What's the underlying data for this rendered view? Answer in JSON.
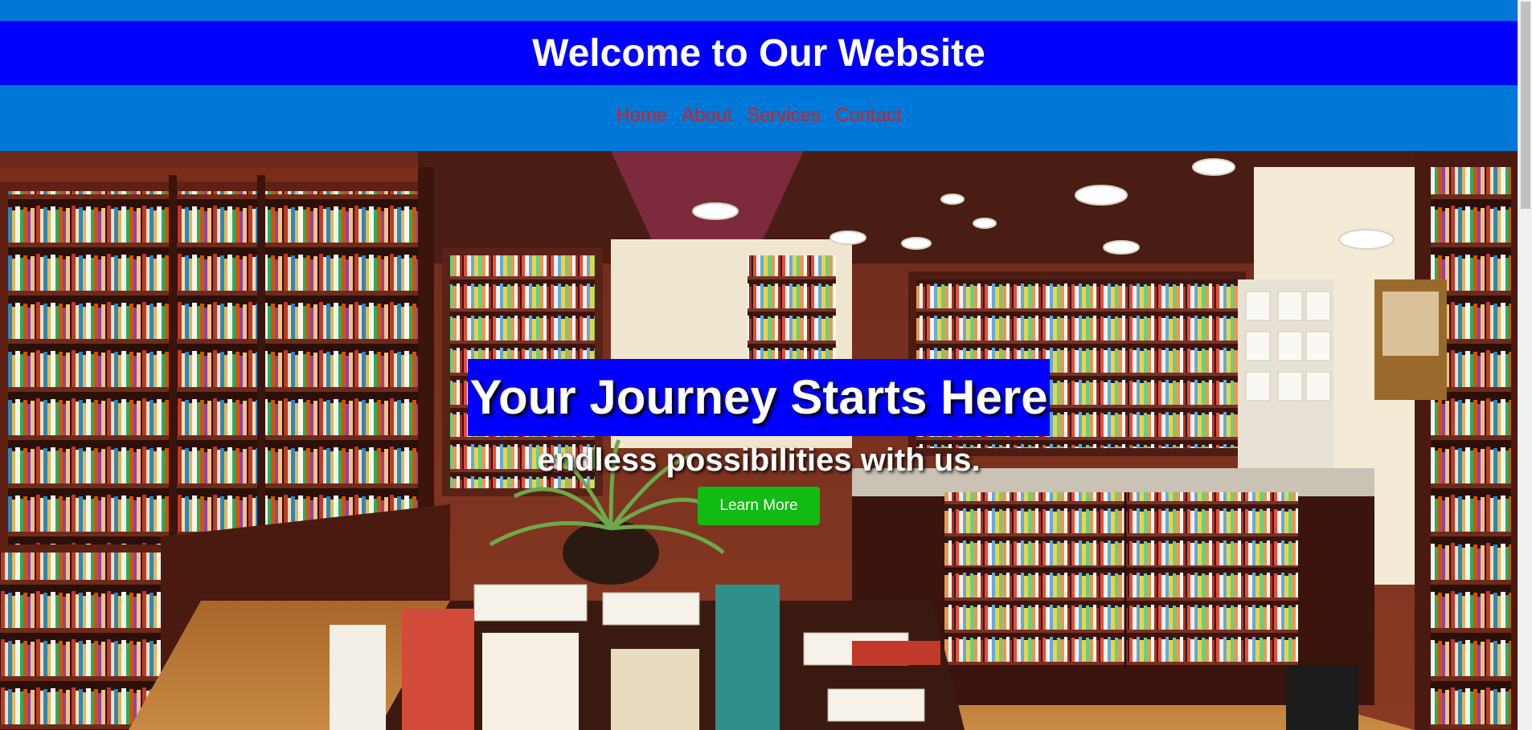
{
  "header": {
    "title": "Welcome to Our Website"
  },
  "nav": {
    "links": [
      "Home",
      "About",
      "Services",
      "Contact"
    ]
  },
  "hero": {
    "title": "Your Journey Starts Here",
    "subtitle": "endless possibilities with us.",
    "button_label": "Learn More",
    "background_image": "bookstore-interior"
  },
  "colors": {
    "top_strip": "#0078d7",
    "header_bg": "#0000ff",
    "nav_bg": "#0078d7",
    "nav_link": "#cc2222",
    "button_bg": "#11bb11"
  }
}
